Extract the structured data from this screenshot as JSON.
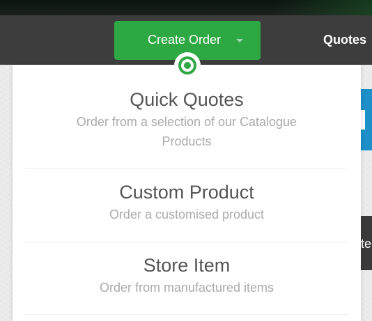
{
  "navbar": {
    "create_order_label": "Create Order",
    "quotes_label": "Quotes",
    "partial_right_text": "te"
  },
  "dropdown": {
    "items": [
      {
        "title": "Quick Quotes",
        "description": "Order from a selection of our Catalogue Products"
      },
      {
        "title": "Custom Product",
        "description": "Order a customised product"
      },
      {
        "title": "Store Item",
        "description": "Order from manufactured items"
      }
    ]
  },
  "colors": {
    "accent_green": "#2ea843",
    "navbar_bg": "#3d3d3d",
    "blue_accent": "#1d8fc9"
  }
}
